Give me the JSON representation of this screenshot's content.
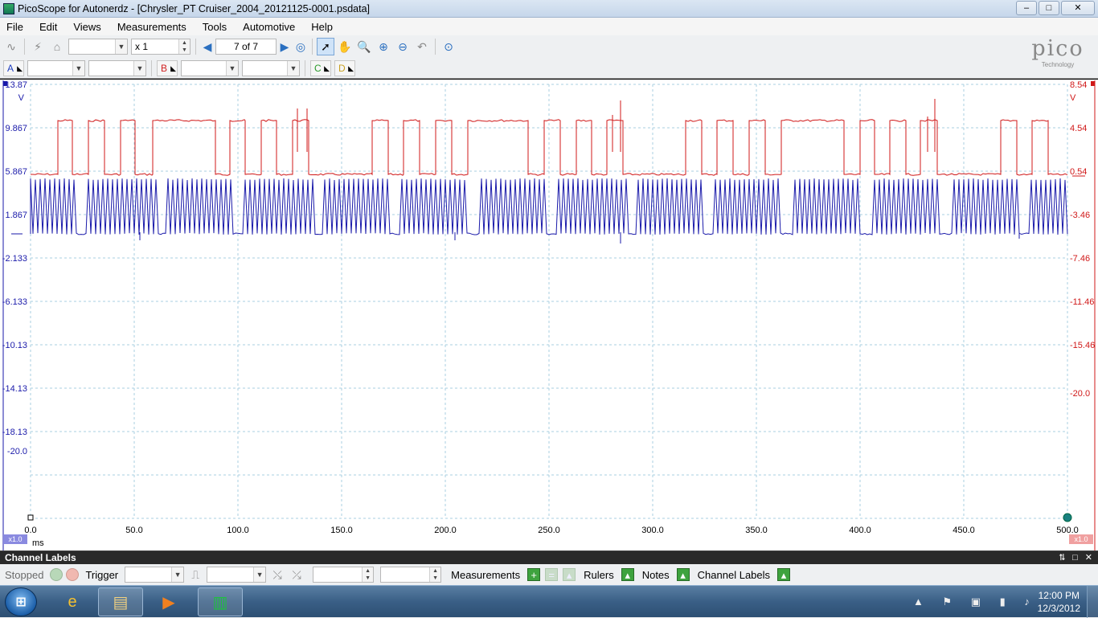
{
  "window": {
    "title": "PicoScope for Autonerdz - [Chrysler_PT Cruiser_2004_20121125-0001.psdata]",
    "buttons": [
      "–",
      "□",
      "✕"
    ]
  },
  "menu": [
    "File",
    "Edit",
    "Views",
    "Measurements",
    "Tools",
    "Automotive",
    "Help"
  ],
  "toolbar": {
    "zoom_value": "x 1",
    "page": "7 of 7",
    "channels": [
      {
        "label": "A",
        "color": "#1f3fc0"
      },
      {
        "label": "B",
        "color": "#d02020"
      },
      {
        "label": "C",
        "color": "#2a9a2a"
      },
      {
        "label": "D",
        "color": "#c8a020"
      }
    ]
  },
  "logo": {
    "name": "pico",
    "sub": "Technology"
  },
  "scope": {
    "left_axis": [
      "13.87",
      "V",
      "9.867",
      "5.867",
      "1.867",
      "-2.133",
      "-6.133",
      "-10.13",
      "-14.13",
      "-18.13",
      "-20.0"
    ],
    "right_axis": [
      "8.54",
      "V",
      "4.54",
      "0.54",
      "-3.46",
      "-7.46",
      "-11.46",
      "-15.46",
      "-20.0"
    ],
    "time_axis": [
      "0.0",
      "50.0",
      "100.0",
      "150.0",
      "200.0",
      "250.0",
      "300.0",
      "350.0",
      "400.0",
      "450.0",
      "500.0"
    ],
    "time_unit": "ms",
    "left_scale": "x1.0",
    "right_scale": "x1.0",
    "colors": {
      "channel_a": "#1a1aaa",
      "channel_b": "#d01818",
      "grid": "#a8cfe0"
    }
  },
  "channel_labels_panel": {
    "title": "Channel Labels",
    "controls": "⮁ □ ✕"
  },
  "statusbar": {
    "state": "Stopped",
    "trigger": "Trigger",
    "measurements": "Measurements",
    "rulers": "Rulers",
    "notes": "Notes",
    "channel_labels": "Channel Labels"
  },
  "taskbar": {
    "time": "12:00 PM",
    "date": "12/3/2012"
  }
}
